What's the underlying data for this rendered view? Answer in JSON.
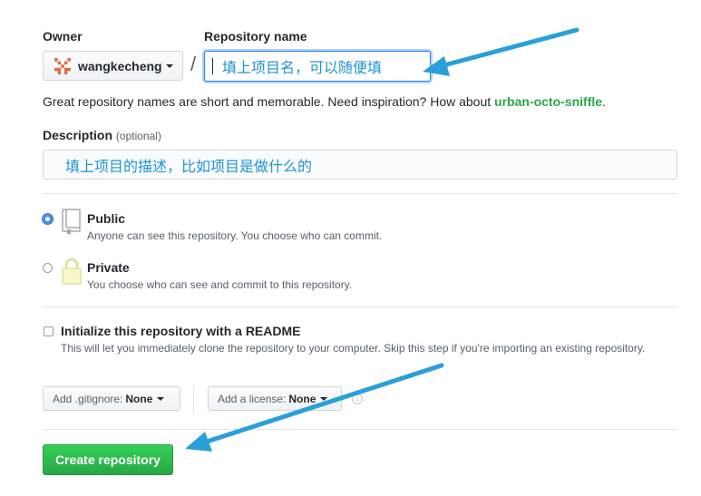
{
  "owner": {
    "label": "Owner",
    "value": "wangkecheng",
    "icon": "identicon-avatar"
  },
  "repo": {
    "label": "Repository name",
    "separator": "/",
    "annotation": "填上项目名，可以随便填"
  },
  "hint": {
    "text": "Great repository names are short and memorable. Need inspiration? How about ",
    "suggestion": "urban-octo-sniffle",
    "end": "."
  },
  "description": {
    "label": "Description",
    "optional": "(optional)",
    "annotation": "填上项目的描述，比如项目是做什么的"
  },
  "visibility": {
    "public": {
      "title": "Public",
      "desc": "Anyone can see this repository. You choose who can commit.",
      "checked": true,
      "icon": "repo-book-icon"
    },
    "private": {
      "title": "Private",
      "desc": "You choose who can see and commit to this repository.",
      "checked": false,
      "icon": "lock-icon"
    }
  },
  "readme": {
    "title": "Initialize this repository with a README",
    "desc": "This will let you immediately clone the repository to your computer. Skip this step if you're importing an existing repository.",
    "checked": false
  },
  "gitignore": {
    "prefix": "Add .gitignore:",
    "value": "None"
  },
  "license": {
    "prefix": "Add a license:",
    "value": "None"
  },
  "create_button": "Create repository",
  "colors": {
    "annotation": "#1e94d6",
    "arrow": "#2a9fd8",
    "accent_green": "#28a745",
    "focus_blue": "#2188ff"
  }
}
